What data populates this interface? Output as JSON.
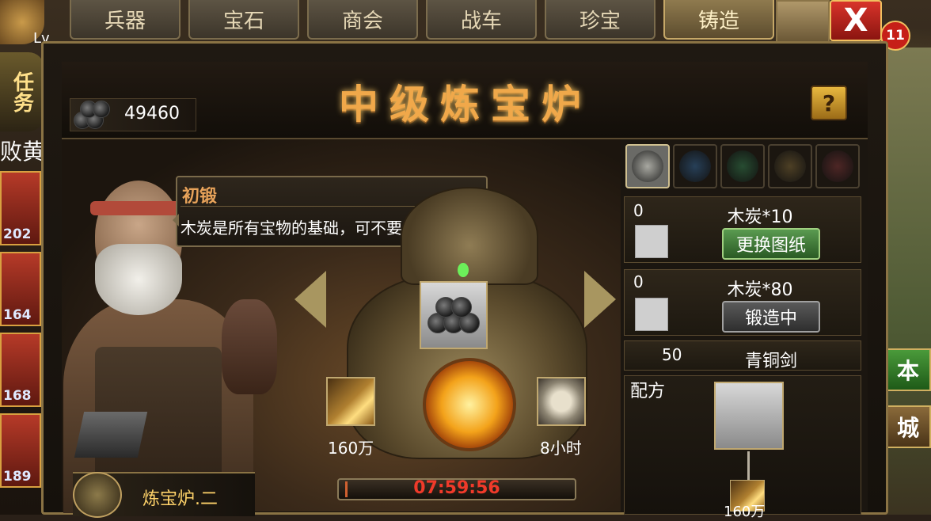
{
  "tabs": [
    "兵器",
    "宝石",
    "商会",
    "战车",
    "珍宝",
    "铸造"
  ],
  "active_tab": "铸造",
  "close_label": "X",
  "notification_count": "11",
  "left_strip": {
    "level_prefix": "Lv",
    "task_label": "任务",
    "quest_text": "败黄",
    "hero_levels": [
      "202",
      "164",
      "168",
      "189"
    ]
  },
  "right_strip": {
    "btn1": "本",
    "btn2": "城"
  },
  "title": "中级炼宝炉",
  "help_label": "?",
  "charcoal_count": "49460",
  "dialogue": {
    "speaker": "初锻",
    "text": "木炭是所有宝物的基础，可不要偷懒哟！"
  },
  "furnace": {
    "cost_left": "160万",
    "cost_right": "8小时",
    "timer": "07:59:56",
    "name": "炼宝炉.二",
    "progress": 0.01
  },
  "recipes": [
    {
      "count": "0",
      "name": "木炭*10",
      "button": "更换图纸",
      "state": "green"
    },
    {
      "count": "0",
      "name": "木炭*80",
      "button": "锻造中",
      "state": "grey"
    },
    {
      "count": "50",
      "name": "青铜剑",
      "button": "",
      "state": ""
    }
  ],
  "gem_colors": [
    "#b8b8b0",
    "#2a4a6a",
    "#2a5a3a",
    "#5a4a2a",
    "#5a2a2a"
  ],
  "formula": {
    "label": "配方",
    "sub_label": "160万"
  }
}
